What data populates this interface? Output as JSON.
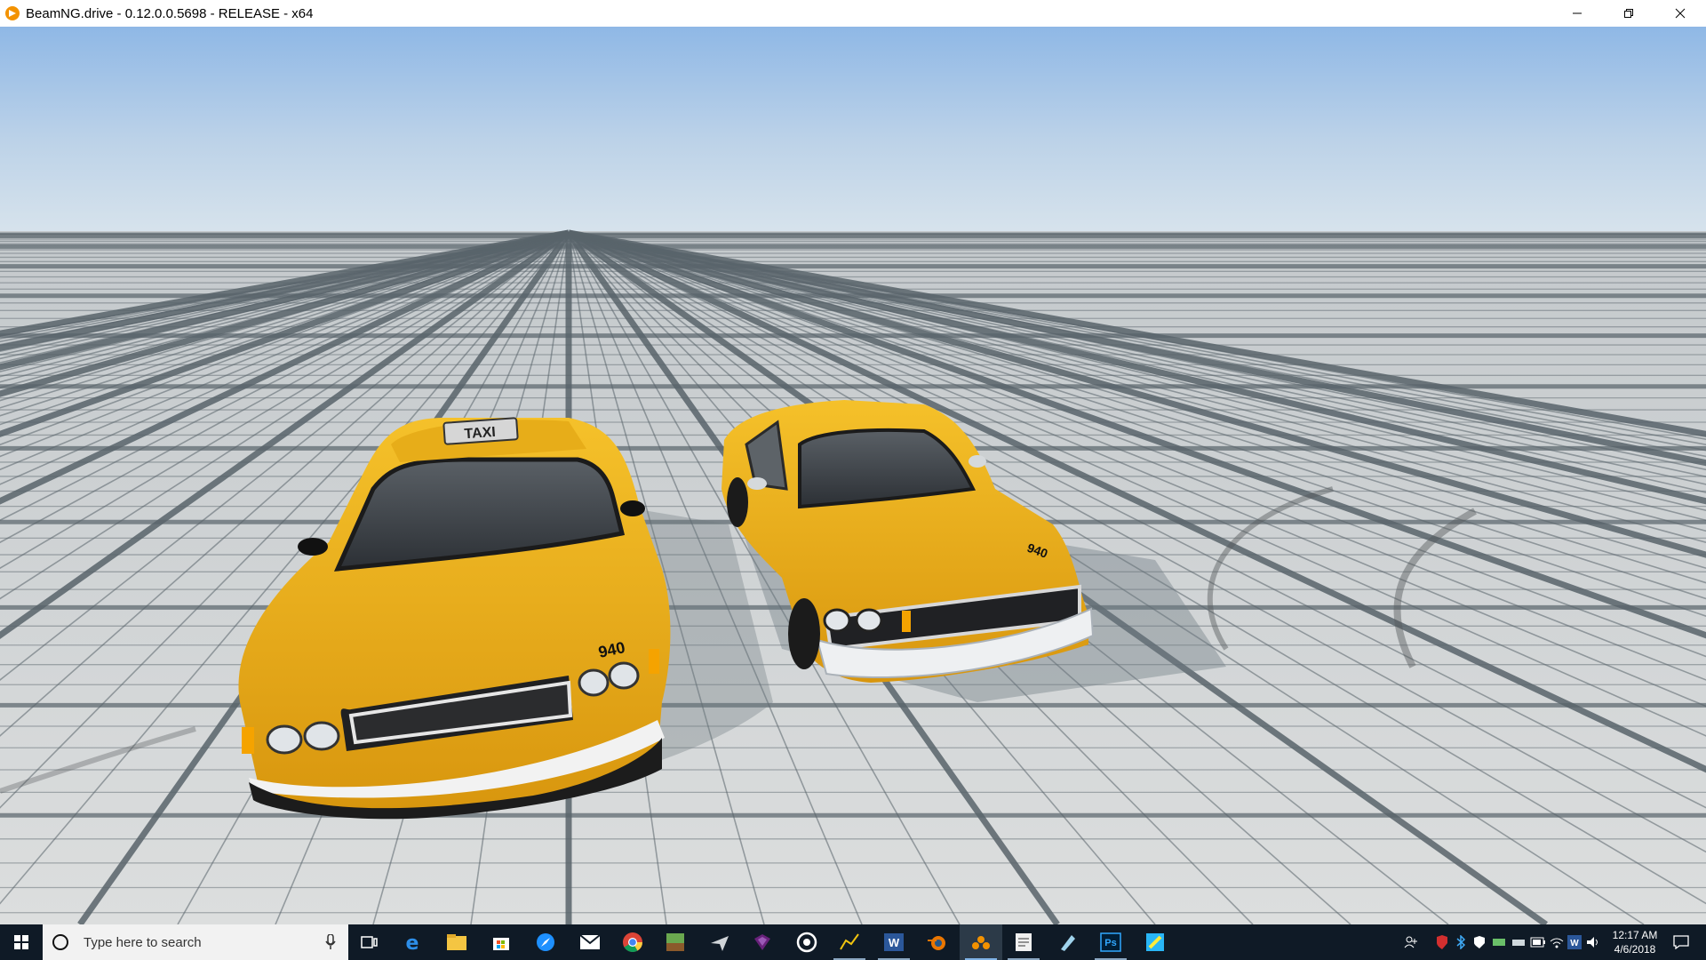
{
  "window": {
    "title": "BeamNG.drive - 0.12.0.0.5698 - RELEASE - x64",
    "colors": {
      "titlebar_bg": "#ffffff",
      "app_icon": "#f39200"
    }
  },
  "scene": {
    "cars": [
      {
        "name": "taxi-car-left",
        "roof_sign": "TAXI",
        "hood_number": "940"
      },
      {
        "name": "taxi-car-right",
        "hood_number": "940"
      }
    ],
    "colors": {
      "sky_top": "#8fb8e6",
      "sky_horizon": "#d7e3ec",
      "ground": "#d4d6d6",
      "grid_line": "#59646b",
      "taxi_yellow": "#f0b21a"
    }
  },
  "taskbar": {
    "search_placeholder": "Type here to search",
    "apps": [
      "task-view-icon",
      "edge-icon",
      "file-explorer-icon",
      "store-icon",
      "safari-icon",
      "mail-icon",
      "chrome-icon",
      "minecraft-icon",
      "plane-app-icon",
      "visual-studio-icon",
      "target-app-icon",
      "graph-app-icon",
      "word-icon",
      "blender-icon",
      "beamng-icon",
      "note-app-icon",
      "paint-app-icon",
      "photoshop-icon",
      "paint-3d-icon"
    ],
    "clock": {
      "time": "12:17 AM",
      "date": "4/6/2018"
    },
    "colors": {
      "bg": "#0f1a26",
      "accent": "#7fb2e5"
    }
  }
}
